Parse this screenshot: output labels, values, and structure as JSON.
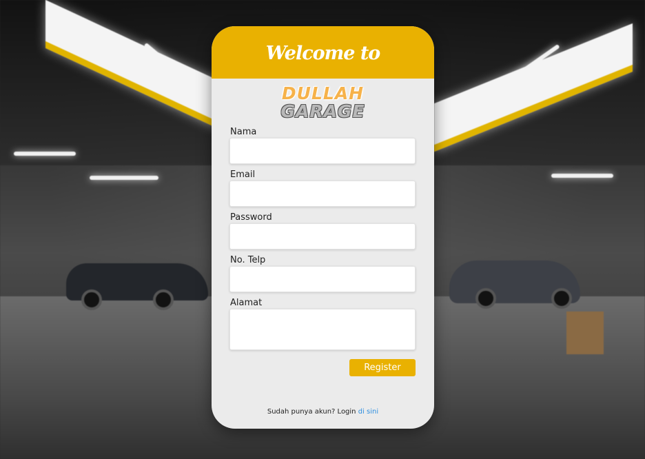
{
  "header": {
    "title": "Welcome to"
  },
  "logo": {
    "line1": "DULLAH",
    "line2": "GARAGE"
  },
  "form": {
    "fields": [
      {
        "label": "Nama",
        "value": "",
        "placeholder": ""
      },
      {
        "label": "Email",
        "value": "",
        "placeholder": ""
      },
      {
        "label": "Password",
        "value": "",
        "placeholder": ""
      },
      {
        "label": "No. Telp",
        "value": "",
        "placeholder": ""
      },
      {
        "label": "Alamat",
        "value": "",
        "placeholder": ""
      }
    ],
    "register_label": "Register"
  },
  "footer": {
    "text": "Sudah punya akun? Login",
    "link_text": "di sini"
  },
  "colors": {
    "accent": "#e9b101",
    "card_bg": "#ebebeb",
    "link": "#2f8fe0"
  }
}
